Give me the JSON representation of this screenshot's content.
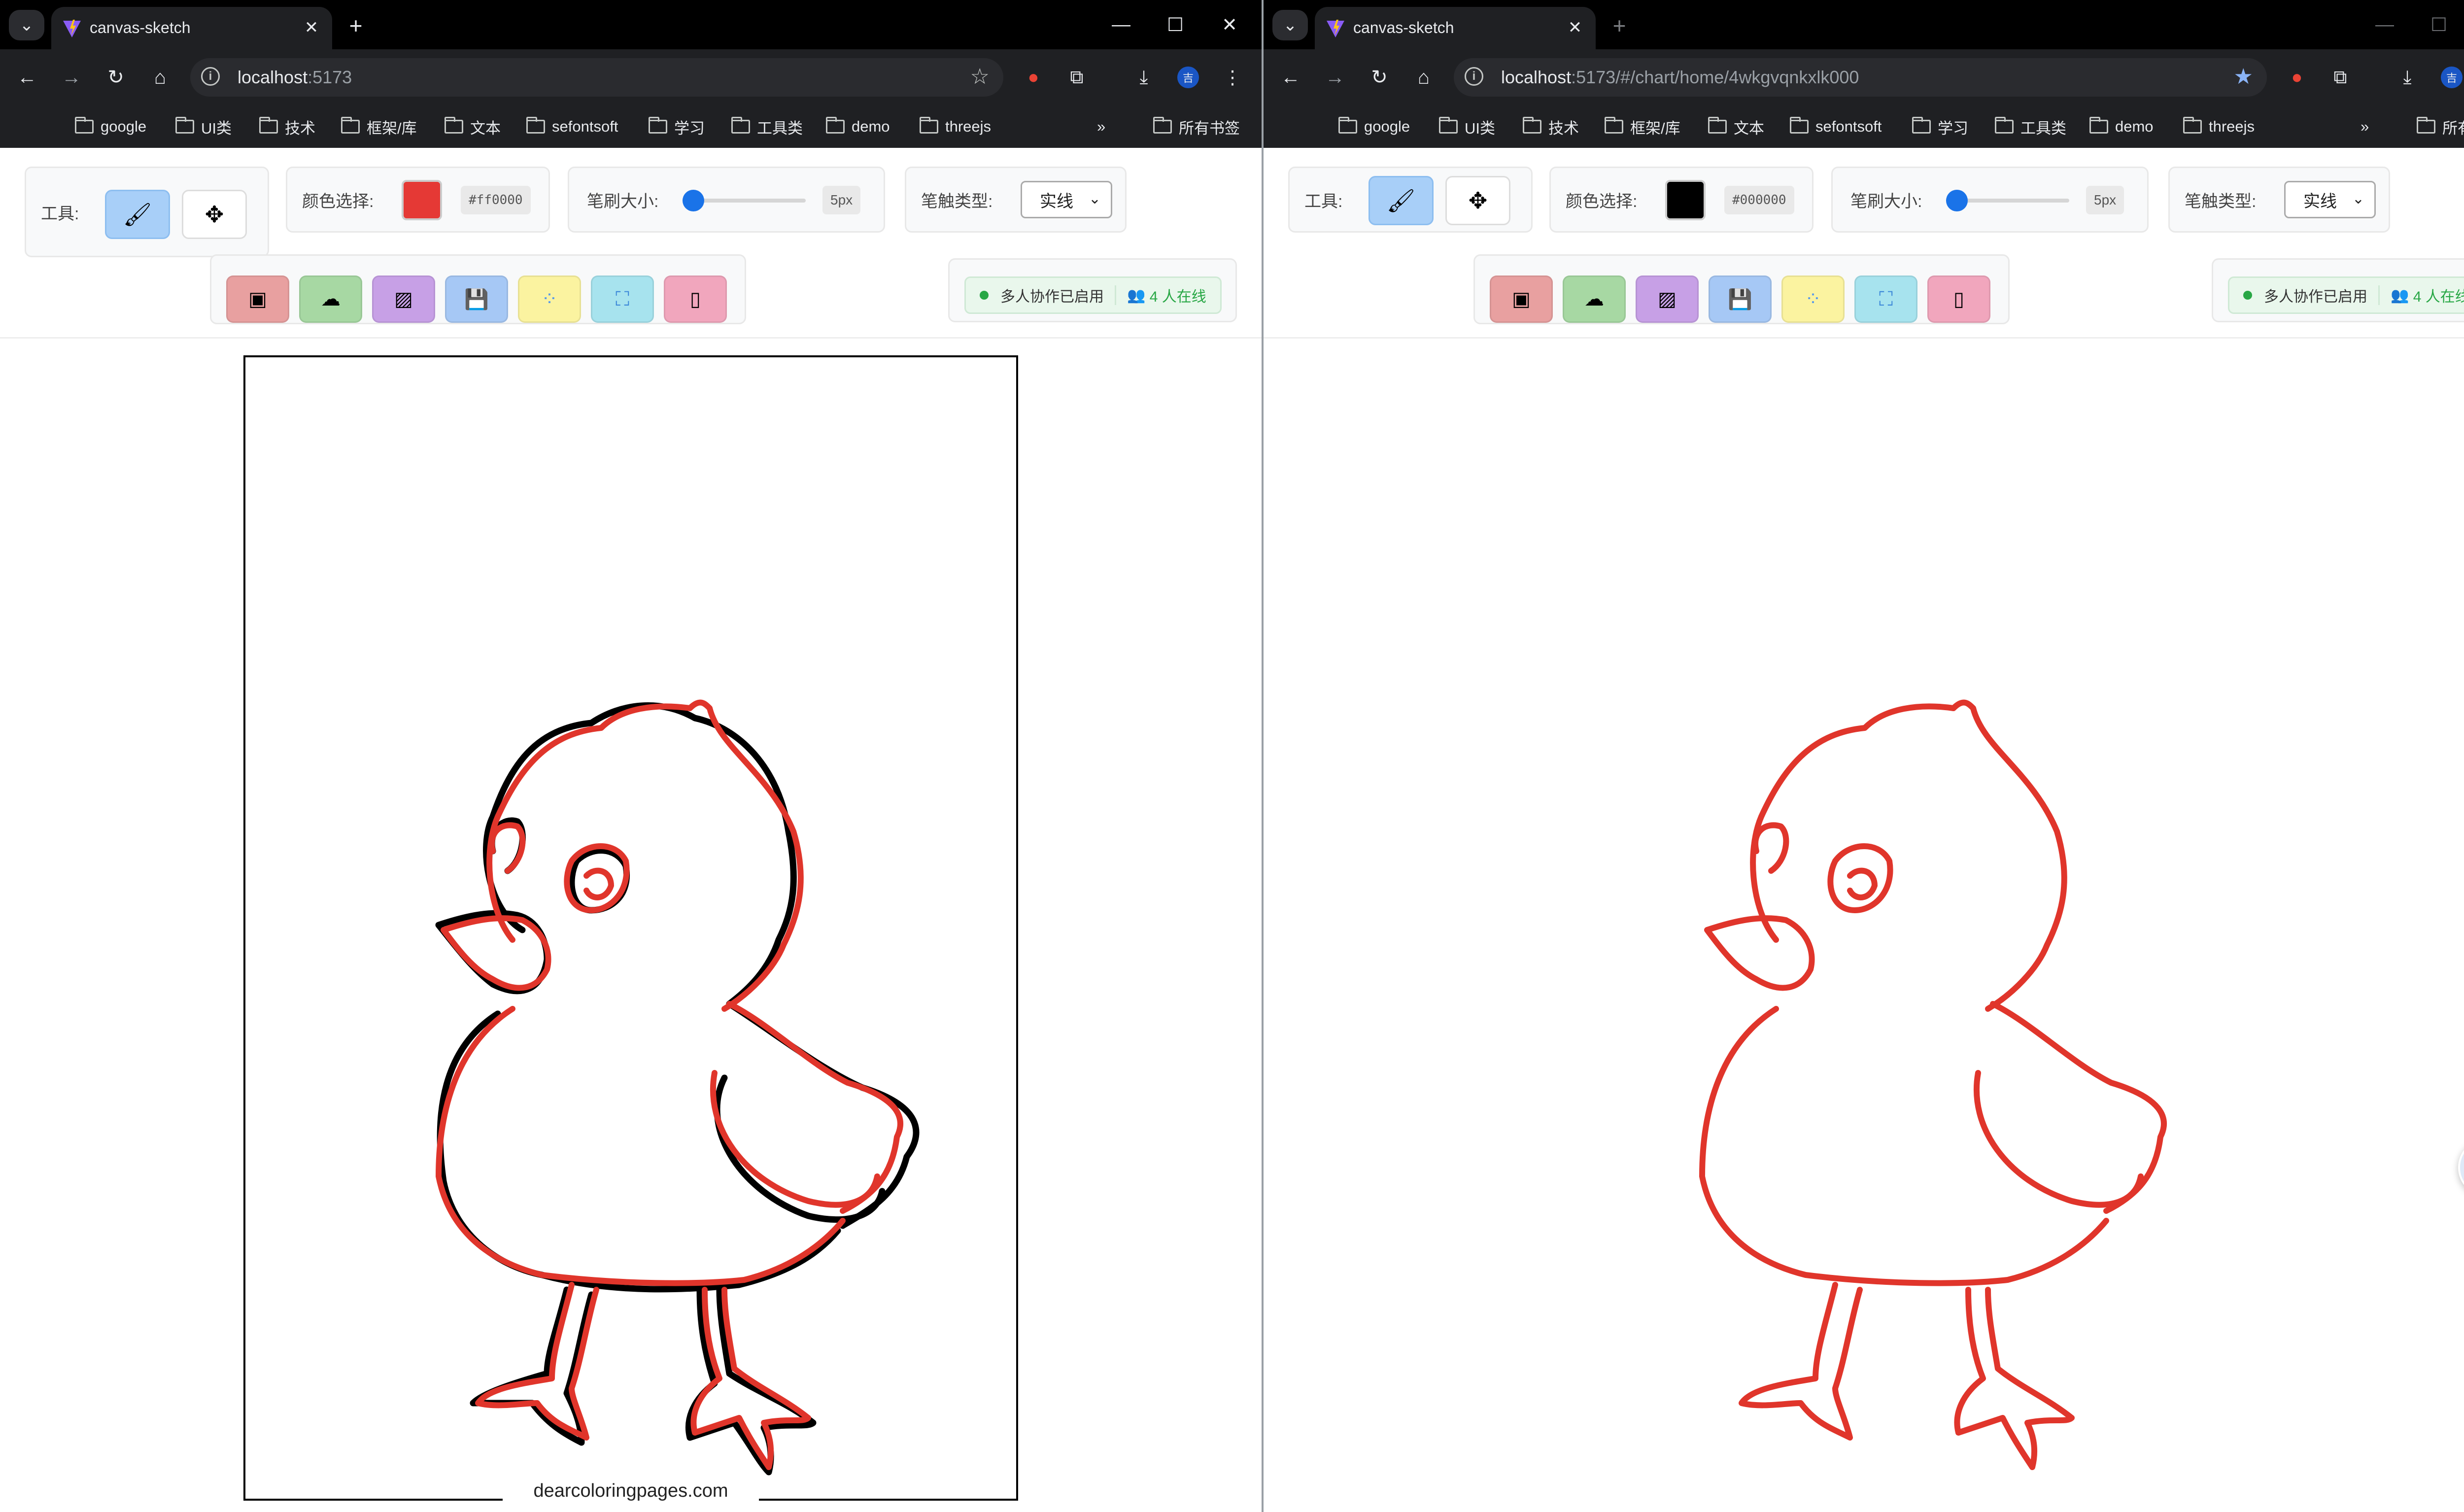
{
  "browser": {
    "tab_title": "canvas-sketch",
    "left_url_host": "localhost",
    "left_url_rest": ":5173",
    "right_url_host": "localhost",
    "right_url_rest": ":5173/#/chart/home/4wkgvqnkxlk000",
    "profile_badge": "吉",
    "bookmarks": [
      "google",
      "UI类",
      "技术",
      "框架/库",
      "文本",
      "sefontsoft",
      "学习",
      "工具类",
      "demo",
      "threejs"
    ],
    "all_bookmarks": "所有书签",
    "more_bookmarks": "»"
  },
  "app": {
    "tool_label": "工具:",
    "color_label": "颜色选择:",
    "size_label": "笔刷大小:",
    "size_value": "5px",
    "size_level_percent": 8,
    "stroke_label": "笔触类型:",
    "stroke_value": "实线",
    "collab_status": "多人协作已启用",
    "online_text": "4 人在线",
    "icons": {
      "brush_tool": "brush-icon",
      "eraser_tool": "eraser-icon",
      "actions": [
        "clear-icon",
        "upload-icon",
        "pattern-icon",
        "save-icon",
        "loading-icon",
        "fullscreen-icon",
        "device-icon"
      ]
    },
    "action_colors": [
      "#e8a0a0",
      "#a7d8a3",
      "#c7a0e6",
      "#a6c8f5",
      "#fbf3a0",
      "#a7e3ee",
      "#f1a6bd"
    ]
  },
  "left_window": {
    "color_value": "#ff0000",
    "color_swatch": "#e53935",
    "image_caption": "dearcoloringpages.com"
  },
  "right_window": {
    "color_value": "#000000",
    "color_swatch": "#000000"
  },
  "drawing": {
    "stroke_color": "#e0352b",
    "outline_color": "#000000"
  }
}
